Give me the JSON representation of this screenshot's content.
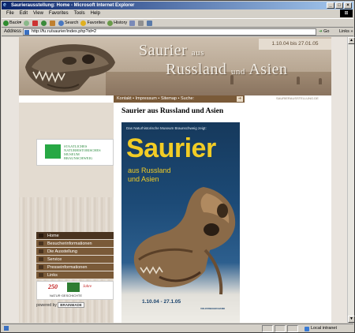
{
  "window": {
    "title": "Saurierausstellung: Home - Microsoft Internet Explorer",
    "controls": [
      "_",
      "□",
      "×"
    ]
  },
  "menubar": [
    "File",
    "Edit",
    "View",
    "Favorites",
    "Tools",
    "Help"
  ],
  "toolbar": {
    "back": "Back",
    "search": "Search",
    "favorites": "Favorites",
    "history": "History"
  },
  "addressbar": {
    "label": "Address",
    "url": "http://fu.ru/saurier/index.php?id=2",
    "go": "Go",
    "links": "Links"
  },
  "site": {
    "dates": "1.10.04 bis 27.01.05",
    "title_word1": "Saurier",
    "title_small1": "aus",
    "title_word2": "Russland",
    "title_small2": "und",
    "title_word3": "Asien",
    "topnav": "Kontakt • Impressum • Sitemap • Suche:",
    "tiny_url": "SAURIERAUSSTELLUNG.DE",
    "logo_text": [
      "STAATLICHES",
      "NATURHISTORISCHES",
      "MUSEUM",
      "BRAUNSCHWEIG"
    ],
    "menu": [
      "Home",
      "Besucherinformationen",
      "Die Ausstellung",
      "Service",
      "Presseinformationen",
      "Links"
    ],
    "anniversary": {
      "number": "250",
      "jahre": "Jahre",
      "text": "NATUR·GESCHICHTE"
    },
    "powered_label": "powered by",
    "powered_brand": "BRAINMADE"
  },
  "content": {
    "heading": "Saurier aus Russland und Asien",
    "poster": {
      "pretitle": "Das Naturhistorische Museum Braunschweig zeigt:",
      "title": "Saurier",
      "line1": "aus Russland",
      "line2": "und Asien",
      "dates": "1.10.04 - 27.1.05",
      "bank": "VOLKSWAGEN BANK"
    }
  },
  "statusbar": {
    "zone": "Local intranet"
  }
}
